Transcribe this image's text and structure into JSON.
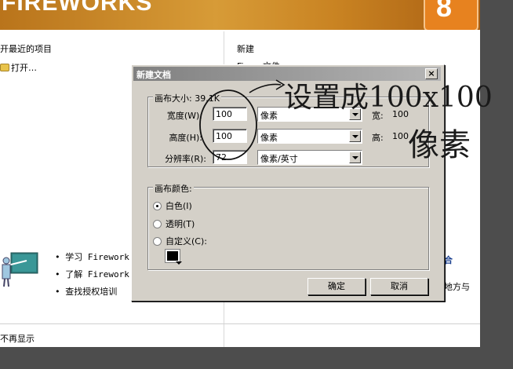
{
  "banner": {
    "title": "FIREWORKS",
    "logo_digit": "8"
  },
  "start_page": {
    "recent_heading": "开最近的项目",
    "open_label": "打开…",
    "new_heading": "新建",
    "new_item": "Fi...... 文件",
    "learn_links": [
      "学习 Firework",
      "了解 Firework",
      "查找授权培训"
    ],
    "right_snip_1": "合",
    "right_snip_2": "地方与",
    "footer_text": "不再显示"
  },
  "dialog": {
    "title": "新建文档",
    "close_label": "×",
    "canvas_size_label": "画布大小: 39.1K",
    "width_label": "宽度(W):",
    "width_value": "100",
    "width_unit": "像素",
    "width_side_label": "宽:",
    "width_side_value": "100",
    "height_label": "高度(H):",
    "height_value": "100",
    "height_unit": "像素",
    "height_side_label": "高:",
    "height_side_value": "100",
    "resolution_label": "分辨率(R):",
    "resolution_value": "72",
    "resolution_unit": "像素/英寸",
    "canvas_color_label": "画布颜色:",
    "options": [
      {
        "label": "白色(I)",
        "checked": true
      },
      {
        "label": "透明(T)",
        "checked": false
      },
      {
        "label": "自定义(C):",
        "checked": false
      }
    ],
    "custom_color": "#000000",
    "ok_label": "确定",
    "cancel_label": "取消"
  },
  "annotation": {
    "line1": "设置成100x100",
    "line2": "像素"
  }
}
